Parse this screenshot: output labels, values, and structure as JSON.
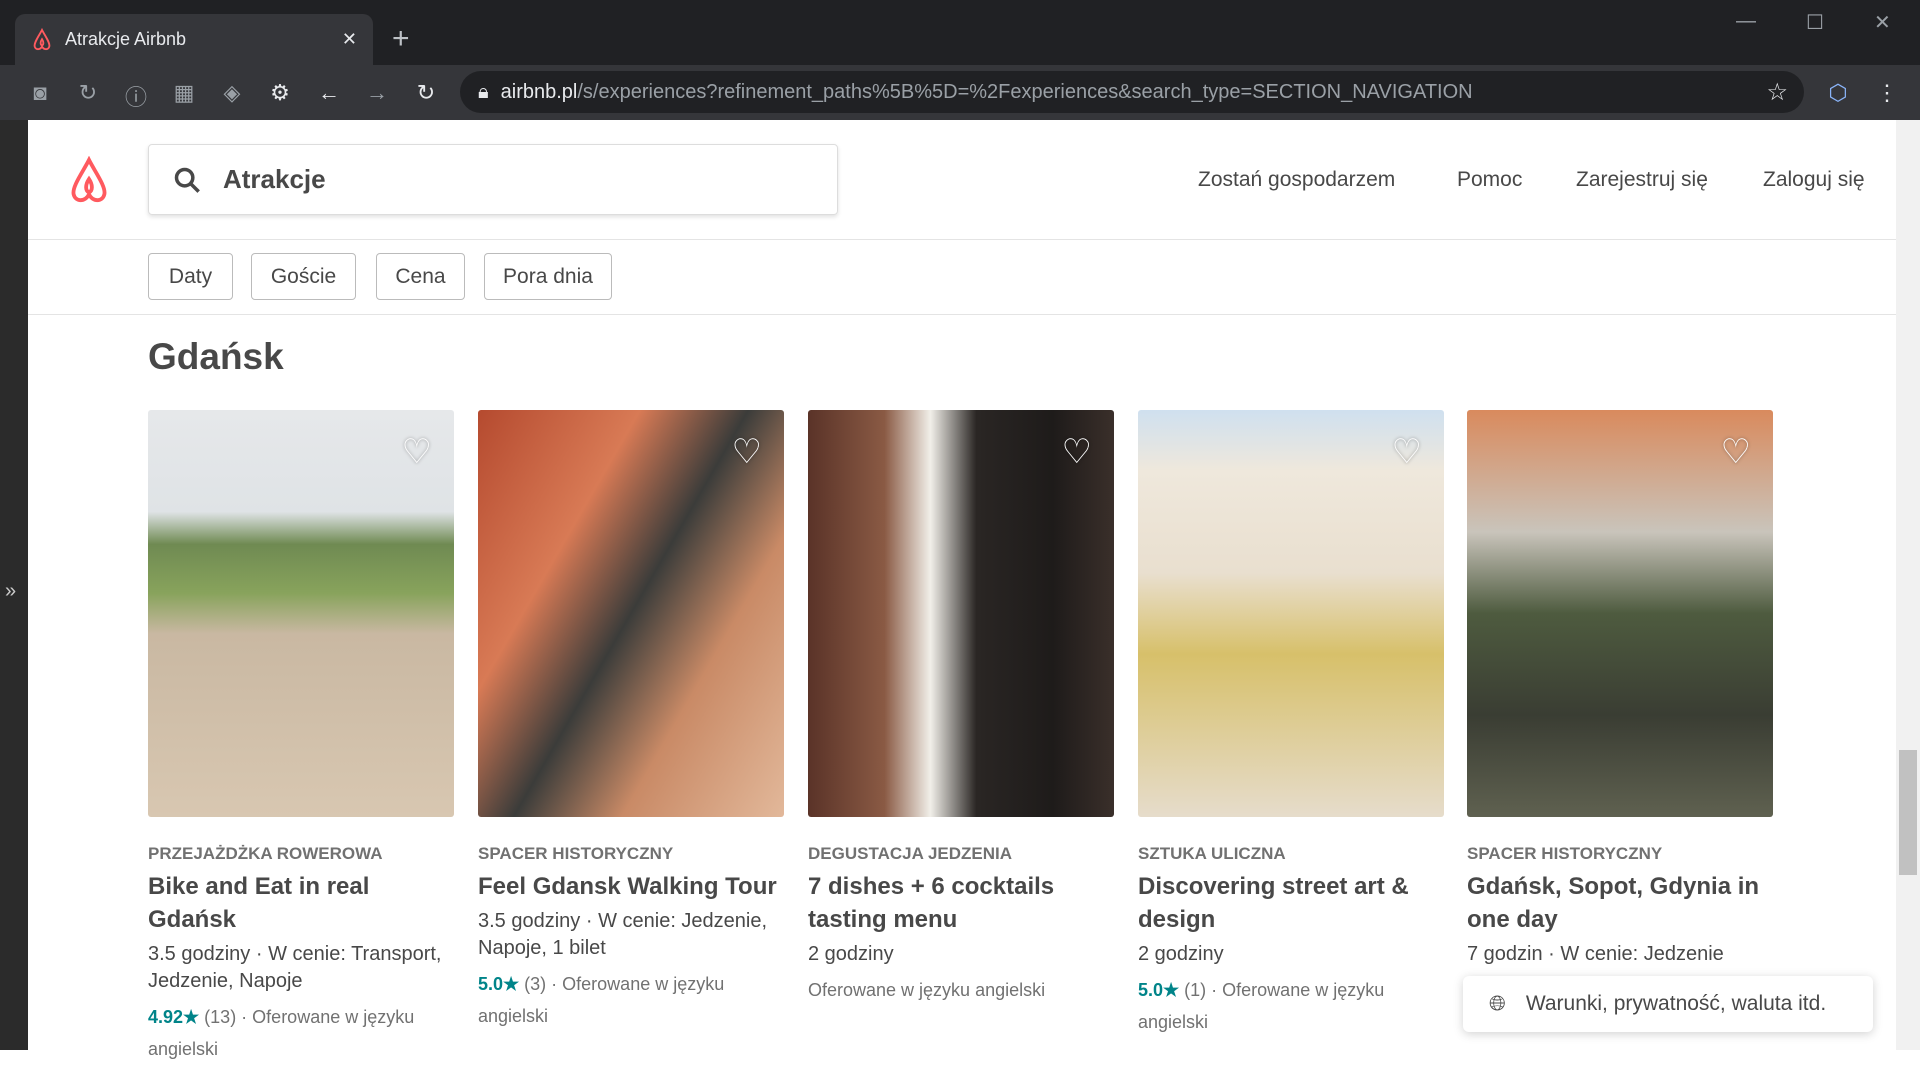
{
  "browser": {
    "tab_title": "Atrakcje Airbnb",
    "url_host": "airbnb.pl",
    "url_path": "/s/experiences?refinement_paths%5B%5D=%2Fexperiences&search_type=SECTION_NAVIGATION"
  },
  "header": {
    "search_value": "Atrakcje",
    "nav": [
      "Zostań gospodarzem",
      "Pomoc",
      "Zarejestruj się",
      "Zaloguj się"
    ]
  },
  "filters": [
    "Daty",
    "Goście",
    "Cena",
    "Pora dnia"
  ],
  "section_title": "Gdańsk",
  "cards": [
    {
      "category": "PRZEJAŻDŻKA ROWEROWA",
      "title": "Bike and Eat in real Gdańsk",
      "details": "3.5 godziny · W cenie: Transport, Jedzenie, Napoje",
      "rating": "4.92★",
      "reviews": " (13) · Oferowane w języku angielski"
    },
    {
      "category": "SPACER HISTORYCZNY",
      "title": "Feel Gdansk Walking Tour",
      "details": "3.5 godziny · W cenie: Jedzenie, Napoje, 1 bilet",
      "rating": "5.0★",
      "reviews": " (3) · Oferowane w języku angielski"
    },
    {
      "category": "DEGUSTACJA JEDZENIA",
      "title": "7 dishes + 6 cocktails tasting menu",
      "details": "2 godziny",
      "rating": "",
      "reviews": "Oferowane w języku angielski"
    },
    {
      "category": "SZTUKA ULICZNA",
      "title": "Discovering street art & design",
      "details": "2 godziny",
      "rating": "5.0★",
      "reviews": " (1) · Oferowane w języku angielski"
    },
    {
      "category": "SPACER HISTORYCZNY",
      "title": "Gdańsk, Sopot, Gdynia in one day",
      "details": "7 godzin · W cenie: Jedzenie",
      "rating": "",
      "reviews": ""
    }
  ],
  "footer": {
    "label": "Warunki, prywatność, waluta itd."
  },
  "colors": {
    "brand": "#FF5A5F",
    "rating": "#008489"
  }
}
